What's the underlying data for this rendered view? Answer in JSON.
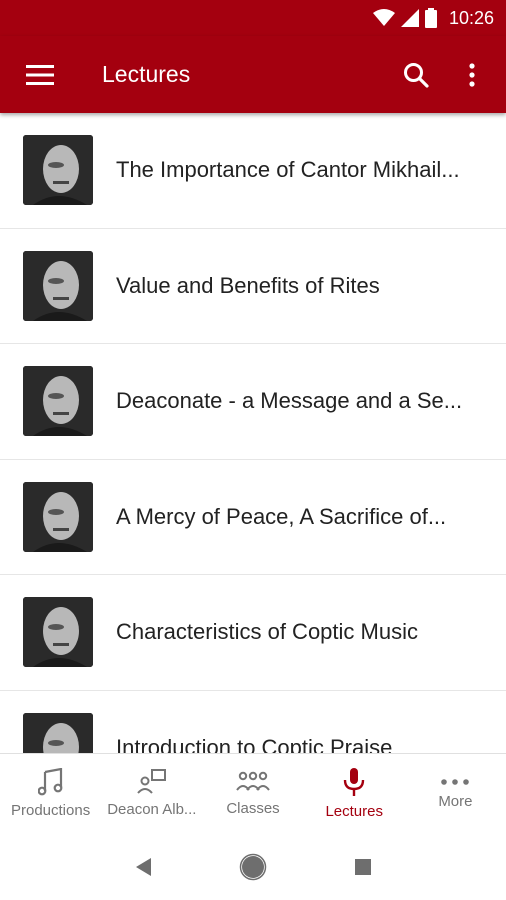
{
  "status": {
    "time": "10:26"
  },
  "appbar": {
    "title": "Lectures",
    "icons": {
      "menu": "menu-icon",
      "search": "search-icon",
      "more": "more-vert-icon"
    },
    "color": "#a4000f"
  },
  "lectures": [
    {
      "title": "The Importance of Cantor Mikhail..."
    },
    {
      "title": "Value and Benefits of Rites"
    },
    {
      "title": "Deaconate - a Message and a Se..."
    },
    {
      "title": "A Mercy of Peace, A Sacrifice of..."
    },
    {
      "title": "Characteristics of Coptic Music"
    },
    {
      "title": "Introduction to Coptic Praise"
    }
  ],
  "bottom_nav": {
    "items": [
      {
        "label": "Productions",
        "icon": "music-note-icon",
        "active": false
      },
      {
        "label": "Deacon Alb...",
        "icon": "deacon-album-icon",
        "active": false
      },
      {
        "label": "Classes",
        "icon": "classes-icon",
        "active": false
      },
      {
        "label": "Lectures",
        "icon": "microphone-icon",
        "active": true
      },
      {
        "label": "More",
        "icon": "more-horiz-icon",
        "active": false
      }
    ],
    "active_color": "#a4000f",
    "inactive_color": "#757575"
  }
}
